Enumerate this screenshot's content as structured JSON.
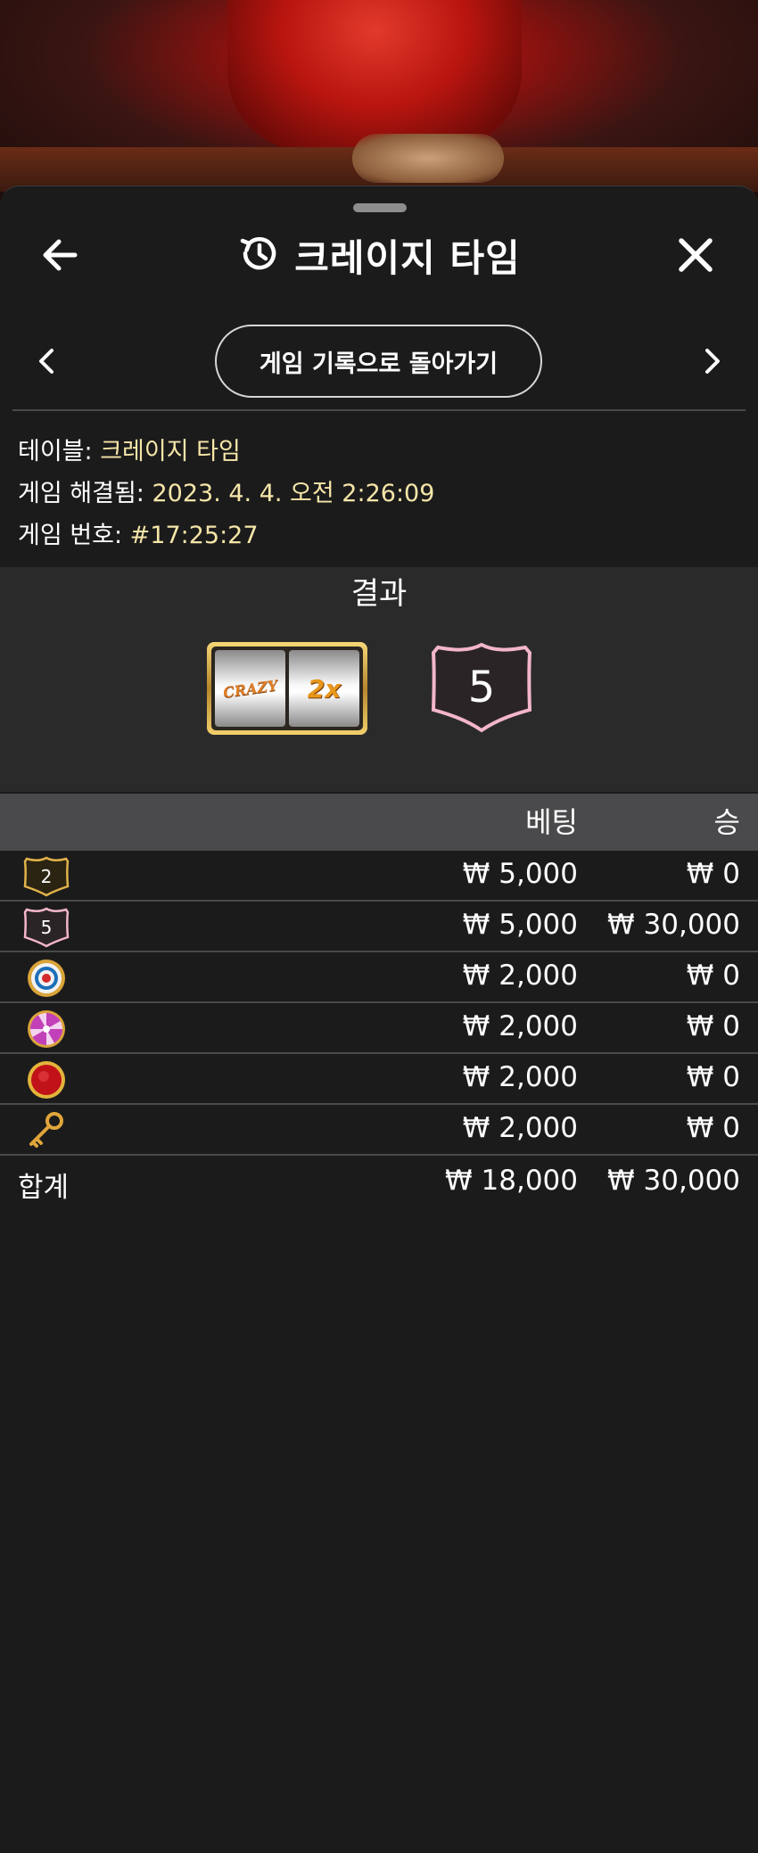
{
  "header": {
    "title": "크레이지 타임",
    "back_icon": "arrow-left-icon",
    "history_icon": "history-icon",
    "close_icon": "close-icon"
  },
  "navigation": {
    "back_to_history_label": "게임 기록으로 돌아가기",
    "prev_icon": "chevron-left-icon",
    "next_icon": "chevron-right-icon"
  },
  "info": {
    "table_label": "테이블:",
    "table_value": "크레이지 타임",
    "resolved_label": "게임 해결됨:",
    "resolved_value": "2023. 4. 4. 오전 2:26:09",
    "game_no_label": "게임 번호:",
    "game_no_value": "#17:25:27"
  },
  "result": {
    "title": "결과",
    "slot_left": "CRAZY",
    "slot_multiplier": "2x",
    "number": "5"
  },
  "table": {
    "col_bet": "베팅",
    "col_win": "승",
    "rows": [
      {
        "icon": "number-2-shield-icon",
        "icon_label": "2",
        "bet": "₩ 5,000",
        "win": "₩ 0"
      },
      {
        "icon": "number-5-shield-icon",
        "icon_label": "5",
        "bet": "₩ 5,000",
        "win": "₩ 30,000"
      },
      {
        "icon": "coin-flip-icon",
        "bet": "₩ 2,000",
        "win": "₩ 0"
      },
      {
        "icon": "pachinko-icon",
        "bet": "₩ 2,000",
        "win": "₩ 0"
      },
      {
        "icon": "cash-hunt-icon",
        "bet": "₩ 2,000",
        "win": "₩ 0"
      },
      {
        "icon": "crazy-time-key-icon",
        "bet": "₩ 2,000",
        "win": "₩ 0"
      }
    ],
    "total_label": "합계",
    "total_bet": "₩ 18,000",
    "total_win": "₩ 30,000"
  },
  "colors": {
    "panel_bg": "#1c1b1c",
    "header_row_bg": "#4a4a4c",
    "info_value": "#f5e6a8",
    "shield_pink": "#f3b6c9",
    "shield_gold": "#e0b34a"
  }
}
